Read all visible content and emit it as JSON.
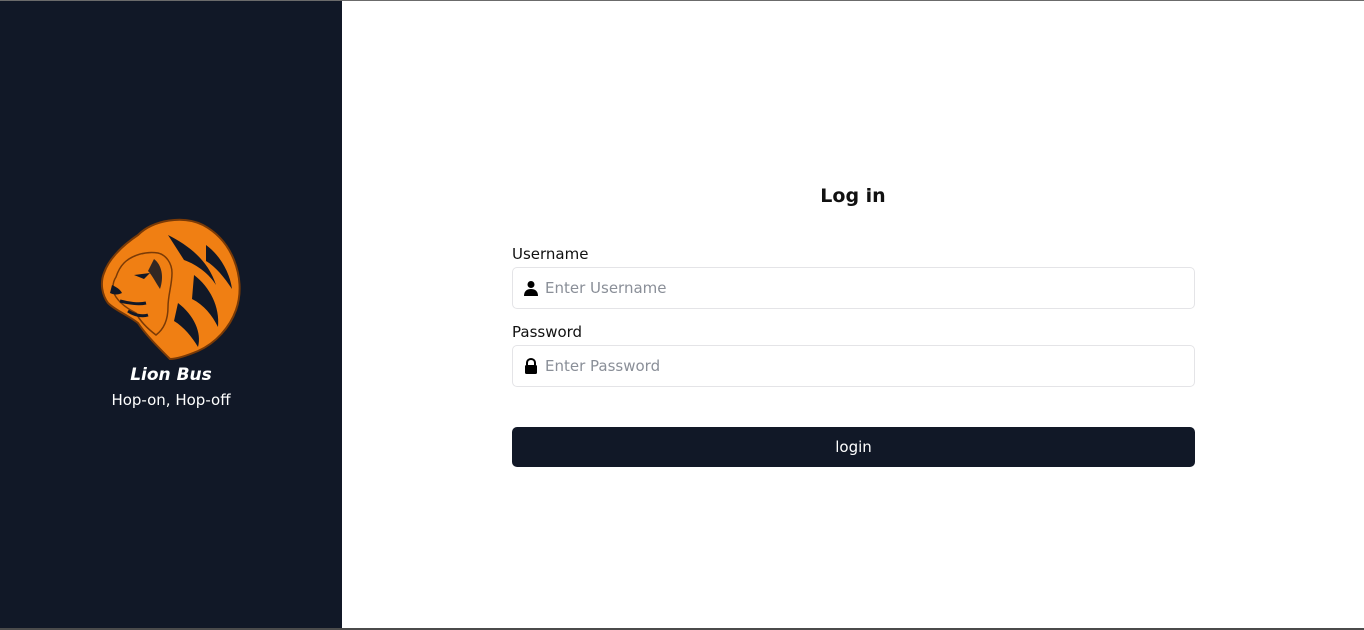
{
  "brand": {
    "name": "Lion Bus",
    "tagline": "Hop-on, Hop-off",
    "logo_icon": "lion-head-icon",
    "accent_color": "#f07f13",
    "sidebar_color": "#111827"
  },
  "form": {
    "title": "Log in",
    "username": {
      "label": "Username",
      "placeholder": "Enter Username",
      "value": "",
      "icon": "user-icon"
    },
    "password": {
      "label": "Password",
      "placeholder": "Enter Password",
      "value": "",
      "icon": "lock-icon"
    },
    "submit_label": "login",
    "button_color": "#111827"
  }
}
